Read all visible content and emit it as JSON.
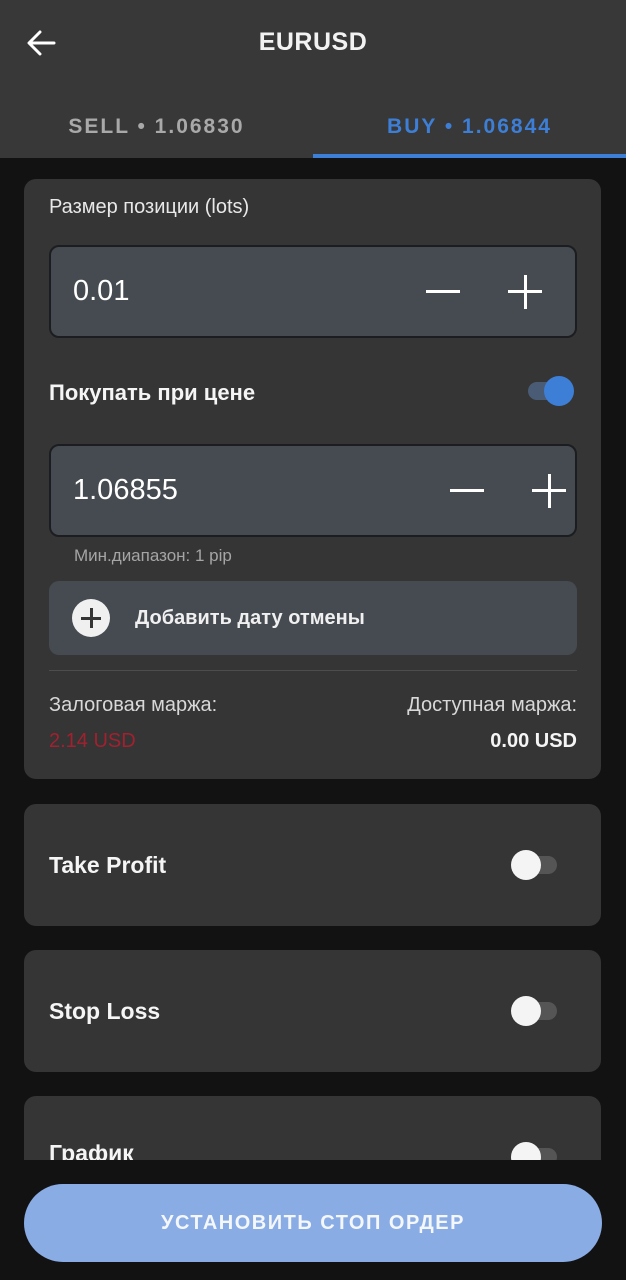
{
  "header": {
    "title": "EURUSD",
    "back_icon": "arrow-left-icon",
    "tabs": [
      {
        "label": "SELL • 1.06830",
        "active": false
      },
      {
        "label": "BUY • 1.06844",
        "active": true
      }
    ],
    "active_color": "#3d7fd6"
  },
  "order": {
    "position_size_label": "Размер позиции (lots)",
    "position_size_value": "0.01",
    "buy_at_price_label": "Покупать при цене",
    "buy_at_price_enabled": true,
    "price_value": "1.06855",
    "min_range_text": "Мин.диапазон: 1 pip",
    "add_cancel_date_label": "Добавить дату отмены",
    "margin": {
      "required_label": "Залоговая маржа:",
      "required_value": "2.14 USD",
      "required_color": "#a3202f",
      "available_label": "Доступная маржа:",
      "available_value": "0.00 USD"
    }
  },
  "options": {
    "take_profit": {
      "label": "Take Profit",
      "enabled": false
    },
    "stop_loss": {
      "label": "Stop Loss",
      "enabled": false
    },
    "chart": {
      "label": "График",
      "enabled": false
    }
  },
  "submit": {
    "label": "УСТАНОВИТЬ СТОП ОРДЕР",
    "color": "#8aace4"
  }
}
